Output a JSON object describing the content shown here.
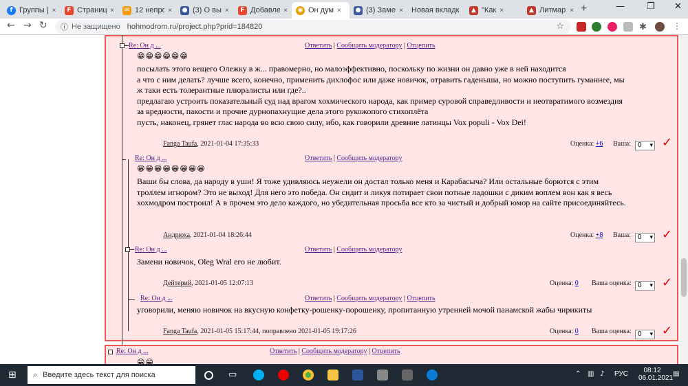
{
  "browser": {
    "tabs": [
      {
        "label": "Группы |",
        "icon": "facebook-icon",
        "color": "#1877f2",
        "glyph": "f"
      },
      {
        "label": "Страниц",
        "icon": "favicon-f-icon",
        "color": "#e8462e",
        "glyph": "F"
      },
      {
        "label": "12 непро",
        "icon": "mail-icon",
        "color": "#f39c12",
        "glyph": "✉"
      },
      {
        "label": "(3) О вы",
        "icon": "user-icon",
        "color": "#3b5998",
        "glyph": "●"
      },
      {
        "label": "Добавле",
        "icon": "favicon-f-icon",
        "color": "#e8462e",
        "glyph": "F"
      },
      {
        "label": "Он дум",
        "icon": "site-icon",
        "color": "#e5a000",
        "glyph": "◉"
      },
      {
        "label": "(3) Замет",
        "icon": "user-icon",
        "color": "#3b5998",
        "glyph": "●"
      },
      {
        "label": "Новая вкладк",
        "icon": "",
        "color": "",
        "glyph": ""
      },
      {
        "label": "\"Как",
        "icon": "litmarket-icon",
        "color": "#c0392b",
        "glyph": "▲"
      },
      {
        "label": "Литмарк",
        "icon": "litmarket-icon",
        "color": "#c0392b",
        "glyph": "▲"
      }
    ],
    "close_glyph": "×",
    "new_tab": "+",
    "url_security": "Не защищено",
    "url": "hohmodrom.ru/project.php?prid=184820"
  },
  "comments": [
    {
      "header": "Re: Он д ...",
      "actions": [
        "Ответить",
        "Сообщить модератору",
        "Отцепить"
      ],
      "emoji": "😁😁😁😁😁😁",
      "lines": [
        "посылать этого вещего Олежку в ж... правомерно, но малоэффективно, поскольку по жизни он давно уже в ней находится",
        "а что с ним делать? лучше всего, конечно, применить дихлофос или даже новичок, отравить гаденыша, но можно поступить гуманнее, мы",
        "ж таки есть толерантные плюралисты или где?..",
        "предлагаю устроить показательный суд над врагом хохмического народа, как пример суровой справедливости и неотвратимого возмездия",
        "за вредности, пакости и прочие дурнопахнущие дела этого рукожопого стихоплёта",
        "пусть, наконец, грянет глас народа во всю свою силу, ибо, как говорили древние латинцы Vox populi - Vox Dei!"
      ],
      "user": "Fanga Taufa",
      "date": ", 2021-01-04 17:35:33",
      "rating_label": "Оценка:",
      "rating": "+6",
      "your_label": "Ваша:",
      "your": "0"
    },
    {
      "header": "Re: Он д ...",
      "actions": [
        "Ответить",
        "Сообщить модератору"
      ],
      "emoji": "😁😁😁😁😁😁😁😁",
      "lines": [
        "Ваши бы слова, да народу в уши! Я тоже удивляюсь неужели он достал только меня и Карабасыча? Или остальные борются с этим",
        "троллем игнором? Это не выход! Для него это победа. Он сидит и ликуя потирает свои потные ладошки с диким воплем вон как я весь",
        "хохмодром построил! А в прочем это дело каждого, но убедительная просьба все кто за чистый и добрый юмор на сайте присоединяйтесь."
      ],
      "user": "Андрюха",
      "date": ", 2021-01-04 18:26:44",
      "rating_label": "Оценка:",
      "rating": "+8",
      "your_label": "Ваша:",
      "your": "0"
    },
    {
      "header": "Re: Он д ...",
      "actions": [
        "Ответить",
        "Сообщить модератору"
      ],
      "lines": [
        "Замени новичок, Oleg Wral его не любит."
      ],
      "user": "Дейтерий",
      "date": ", 2021-01-05 12:07:13",
      "rating_label": "Оценка:",
      "rating": "0",
      "your_label": "Ваша оценка:",
      "your": "0"
    },
    {
      "header": "Re: Он д ...",
      "actions": [
        "Ответить",
        "Сообщить модератору",
        "Отцепить"
      ],
      "lines": [
        "уговорили, меняю новичок на вкусную конфетку-рошенку-порошенку, пропитанную утренней мочой панамской жабы чирикиты"
      ],
      "user": "Fanga Taufa",
      "date": ", 2021-01-05 15:17:44, поправлено 2021-01-05 19:17:26",
      "rating_label": "Оценка:",
      "rating": "0",
      "your_label": "Ваша оценка:",
      "your": "0"
    },
    {
      "header": "Re: Он д ...",
      "actions": [
        "Ответить",
        "Сообщить модератору",
        "Отцепить"
      ],
      "emoji": "😁😁"
    }
  ],
  "taskbar": {
    "search_placeholder": "Введите здесь текст для поиска",
    "lang": "РУС",
    "time": "08:12",
    "date": "06.01.2021"
  }
}
